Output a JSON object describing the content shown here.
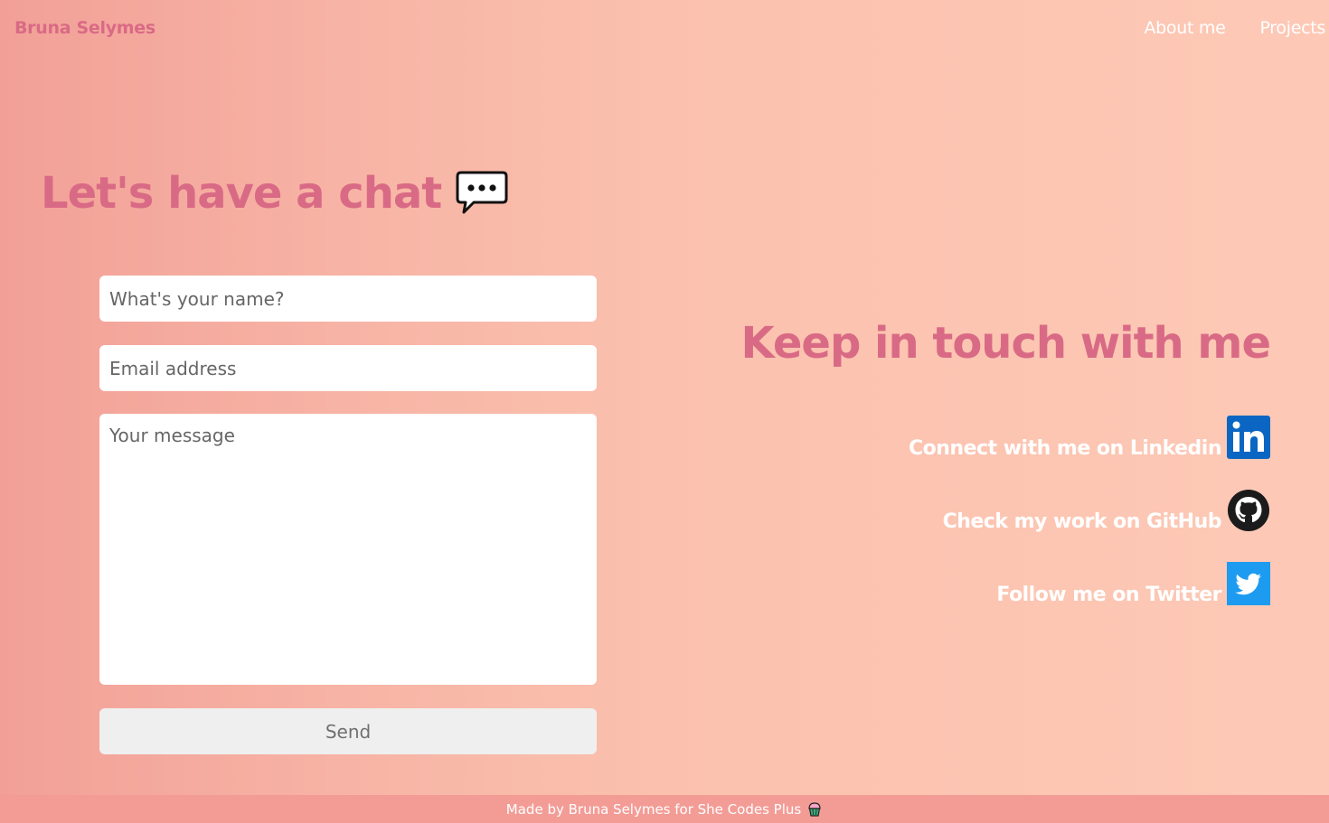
{
  "header": {
    "brand": "Bruna Selymes",
    "nav": [
      {
        "label": "About me"
      },
      {
        "label": "Projects"
      }
    ]
  },
  "contact_form": {
    "title": "Let's have a chat",
    "title_icon": "speech-bubble-icon",
    "name_placeholder": "What's your name?",
    "email_placeholder": "Email address",
    "message_placeholder": "Your message",
    "send_label": "Send"
  },
  "social": {
    "title": "Keep in touch with me",
    "links": [
      {
        "label": "Connect with me on Linkedin",
        "icon": "linkedin-icon"
      },
      {
        "label": "Check my work on GitHub",
        "icon": "github-icon"
      },
      {
        "label": "Follow me on Twitter",
        "icon": "twitter-icon"
      }
    ]
  },
  "footer": {
    "text": "Made by Bruna Selymes for She Codes Plus",
    "icon": "cupcake-icon"
  },
  "colors": {
    "accent": "#d96a85",
    "footer_bg": "#f39c96",
    "linkedin": "#0a66c2",
    "twitter": "#1d9bf0"
  }
}
